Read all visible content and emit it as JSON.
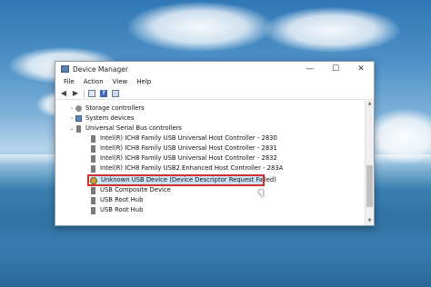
{
  "window": {
    "title": "Device Manager",
    "controls": {
      "minimize": "—",
      "maximize": "☐",
      "close": "✕"
    }
  },
  "menu": [
    "File",
    "Action",
    "View",
    "Help"
  ],
  "toolbar": {
    "icons": [
      "back-icon",
      "forward-icon",
      "properties-icon",
      "help-icon",
      "device-view-icon"
    ]
  },
  "tree": {
    "items": [
      {
        "label": "Storage controllers",
        "expander": "›",
        "icon": "storage-icon"
      },
      {
        "label": "System devices",
        "expander": "›",
        "icon": "system-icon"
      },
      {
        "label": "Universal Serial Bus controllers",
        "expander": "⌄",
        "icon": "usb-icon"
      },
      {
        "label": "Intel(R) ICH8 Family USB Universal Host Controller - 2830",
        "icon": "usb-icon"
      },
      {
        "label": "Intel(R) ICH8 Family USB Universal Host Controller - 2831",
        "icon": "usb-icon"
      },
      {
        "label": "Intel(R) ICH8 Family USB Universal Host Controller - 2832",
        "icon": "usb-icon"
      },
      {
        "label": "Intel(R) ICH8 Family USB2 Enhanced Host Controller - 283A",
        "icon": "usb-icon"
      },
      {
        "label": "Unknown USB Device (Device Descriptor Request Failed)",
        "icon": "warning-icon",
        "highlighted": true
      },
      {
        "label": "USB Composite Device",
        "icon": "usb-icon"
      },
      {
        "label": "USB Root Hub",
        "icon": "usb-icon"
      },
      {
        "label": "USB Root Hub",
        "icon": "usb-icon"
      }
    ]
  },
  "colors": {
    "highlight_border": "#d32f2f",
    "selection": "#cce4f7"
  }
}
